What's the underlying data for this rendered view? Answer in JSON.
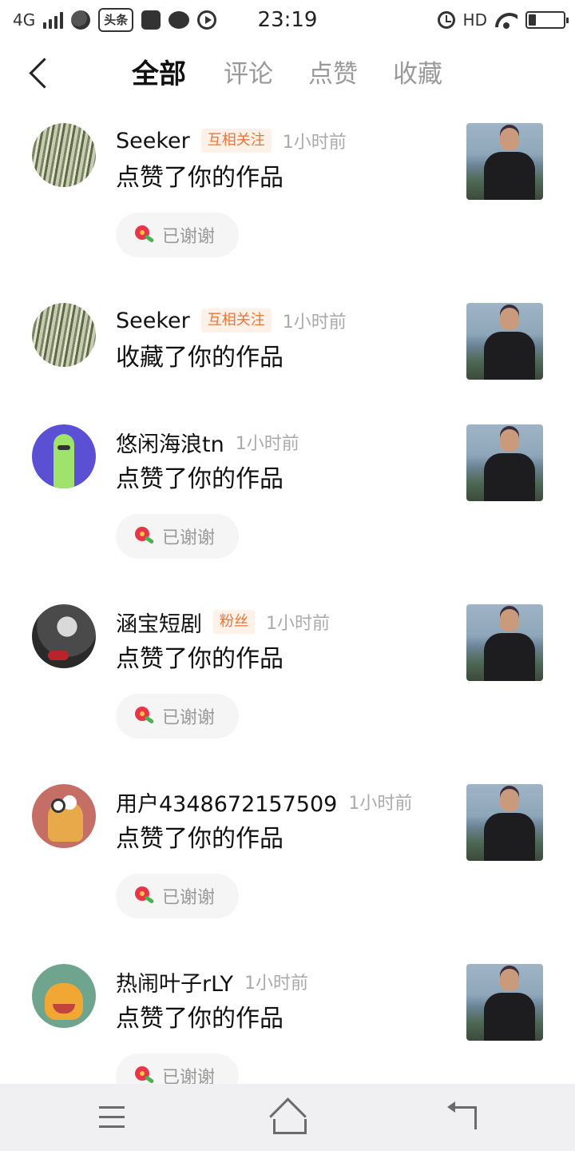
{
  "status_bar": {
    "network": "4G",
    "toutiao_label": "头条",
    "time": "23:19",
    "hd": "HD"
  },
  "tabs": [
    {
      "label": "全部",
      "active": true
    },
    {
      "label": "评论",
      "active": false
    },
    {
      "label": "点赞",
      "active": false
    },
    {
      "label": "收藏",
      "active": false
    }
  ],
  "notifications": [
    {
      "username": "Seeker",
      "badge": "互相关注",
      "time": "1小时前",
      "action": "点赞了你的作品",
      "thanks": "已谢谢",
      "avatar": "forest-avatar"
    },
    {
      "username": "Seeker",
      "badge": "互相关注",
      "time": "1小时前",
      "action": "收藏了你的作品",
      "thanks": "",
      "avatar": "forest-avatar"
    },
    {
      "username": "悠闲海浪tn",
      "badge": "",
      "time": "1小时前",
      "action": "点赞了你的作品",
      "thanks": "已谢谢",
      "avatar": "cactus-avatar"
    },
    {
      "username": "涵宝短剧",
      "badge": "粉丝",
      "time": "1小时前",
      "action": "点赞了你的作品",
      "thanks": "已谢谢",
      "avatar": "girl-avatar"
    },
    {
      "username": "用户4348672157509",
      "badge": "",
      "time": "1小时前",
      "action": "点赞了你的作品",
      "thanks": "已谢谢",
      "avatar": "sausage-avatar"
    },
    {
      "username": "热闹叶子rLY",
      "badge": "",
      "time": "1小时前",
      "action": "点赞了你的作品",
      "thanks": "已谢谢",
      "avatar": "monster-avatar"
    }
  ],
  "icons": {
    "back": "chevron-left-icon",
    "thanks": "flower-icon",
    "nav_menu": "menu-icon",
    "nav_home": "home-icon",
    "nav_back": "return-icon"
  },
  "colors": {
    "badge_text": "#e8763a",
    "badge_bg": "#fdf1e8",
    "secondary_text": "#aaaaaa",
    "nav_bg": "#f0f0f2"
  }
}
